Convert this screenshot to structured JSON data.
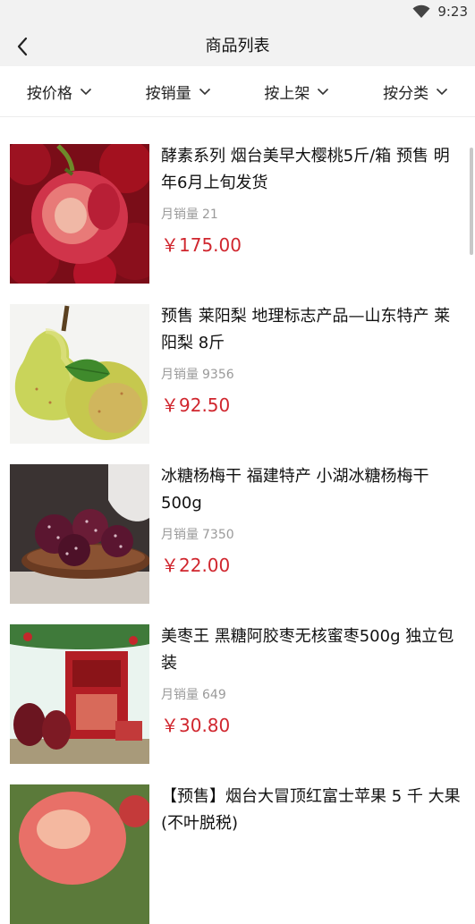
{
  "status_bar": {
    "time": "9:23",
    "icons": [
      "wifi-icon"
    ]
  },
  "header": {
    "title": "商品列表",
    "back_icon": "chevron-left-icon"
  },
  "filters": [
    {
      "label": "按价格",
      "icon": "chevron-down-icon"
    },
    {
      "label": "按销量",
      "icon": "chevron-down-icon"
    },
    {
      "label": "按上架",
      "icon": "chevron-down-icon"
    },
    {
      "label": "按分类",
      "icon": "chevron-down-icon"
    }
  ],
  "products": [
    {
      "title": "酵素系列 烟台美早大樱桃5斤/箱 预售 明年6月上旬发货",
      "sales_label": "月销量",
      "sales": "21",
      "price": "￥175.00",
      "image": "cherry"
    },
    {
      "title": "预售 莱阳梨 地理标志产品—山东特产 莱阳梨 8斤",
      "sales_label": "月销量",
      "sales": "9356",
      "price": "￥92.50",
      "image": "pear"
    },
    {
      "title": "冰糖杨梅干 福建特产 小湖冰糖杨梅干 500g",
      "sales_label": "月销量",
      "sales": "7350",
      "price": "￥22.00",
      "image": "bayberry"
    },
    {
      "title": "美枣王 黑糖阿胶枣无核蜜枣500g 独立包装",
      "sales_label": "月销量",
      "sales": "649",
      "price": "￥30.80",
      "image": "dates"
    },
    {
      "title": "【预售】烟台大冒顶红富士苹果 5 千 大果 (不叶脱税)",
      "sales_label": "",
      "sales": "",
      "price": "",
      "image": "apple"
    }
  ],
  "colors": {
    "price": "#d0262e",
    "header_bg": "#f2f2f2",
    "muted": "#9a9a9a"
  }
}
